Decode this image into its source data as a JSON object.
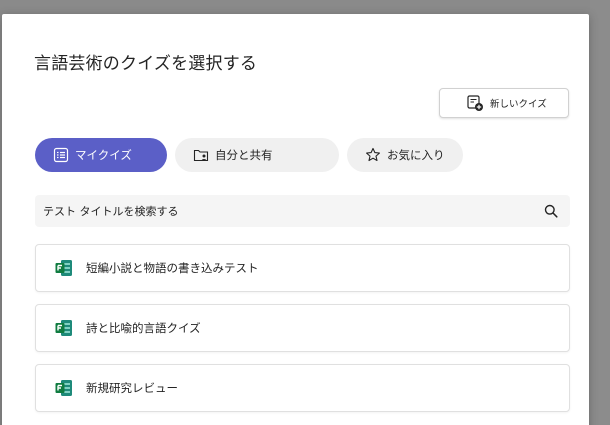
{
  "dialog": {
    "title": "言語芸術のクイズを選択する"
  },
  "toolbar": {
    "new_quiz_label": "新しいクイズ",
    "new_quiz_icon": "new-form-icon"
  },
  "tabs": [
    {
      "label": "マイクイズ",
      "icon": "list-icon",
      "selected": true
    },
    {
      "label": "自分と共有",
      "icon": "shared-folder-icon",
      "selected": false
    },
    {
      "label": "お気に入り",
      "icon": "star-icon",
      "selected": false
    }
  ],
  "search": {
    "placeholder": "テスト タイトルを検索する",
    "icon": "search-icon"
  },
  "quizzes": [
    {
      "title": "短編小説と物語の書き込みテスト",
      "icon": "forms-icon"
    },
    {
      "title": "詩と比喩的言語クイズ",
      "icon": "forms-icon"
    },
    {
      "title": "新規研究レビュー",
      "icon": "forms-icon"
    }
  ],
  "colors": {
    "accent": "#5b5fc7",
    "forms_green": "#107c41",
    "forms_teal": "#1e8a7a"
  }
}
